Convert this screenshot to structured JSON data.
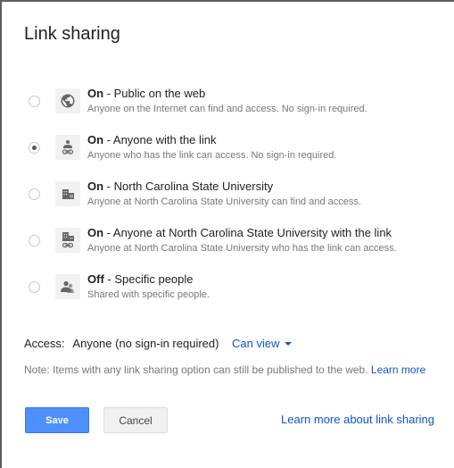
{
  "dialog": {
    "title": "Link sharing"
  },
  "options": [
    {
      "state": "On",
      "separator": " - ",
      "label": "Public on the web",
      "description": "Anyone on the Internet can find and access. No sign-in required.",
      "icon": "globe-icon",
      "selected": false
    },
    {
      "state": "On",
      "separator": " - ",
      "label": "Anyone with the link",
      "description": "Anyone who has the link can access. No sign-in required.",
      "icon": "person-link-icon",
      "selected": true
    },
    {
      "state": "On",
      "separator": " - ",
      "label": "North Carolina State University",
      "description": "Anyone at North Carolina State University can find and access.",
      "icon": "building-icon",
      "selected": false
    },
    {
      "state": "On",
      "separator": " - ",
      "label": "Anyone at North Carolina State University with the link",
      "description": "Anyone at North Carolina State University who has the link can access.",
      "icon": "building-link-icon",
      "selected": false
    },
    {
      "state": "Off",
      "separator": " - ",
      "label": "Specific people",
      "description": "Shared with specific people.",
      "icon": "people-icon",
      "selected": false
    }
  ],
  "access": {
    "label": "Access:",
    "value": "Anyone (no sign-in required)",
    "permission": "Can view"
  },
  "note": {
    "text": "Note: Items with any link sharing option can still be published to the web.",
    "link": "Learn more"
  },
  "footer": {
    "save_label": "Save",
    "cancel_label": "Cancel",
    "learn_more_label": "Learn more about link sharing"
  },
  "colors": {
    "primary": "#4d90fe",
    "link": "#1155cc",
    "icon": "#666666"
  }
}
